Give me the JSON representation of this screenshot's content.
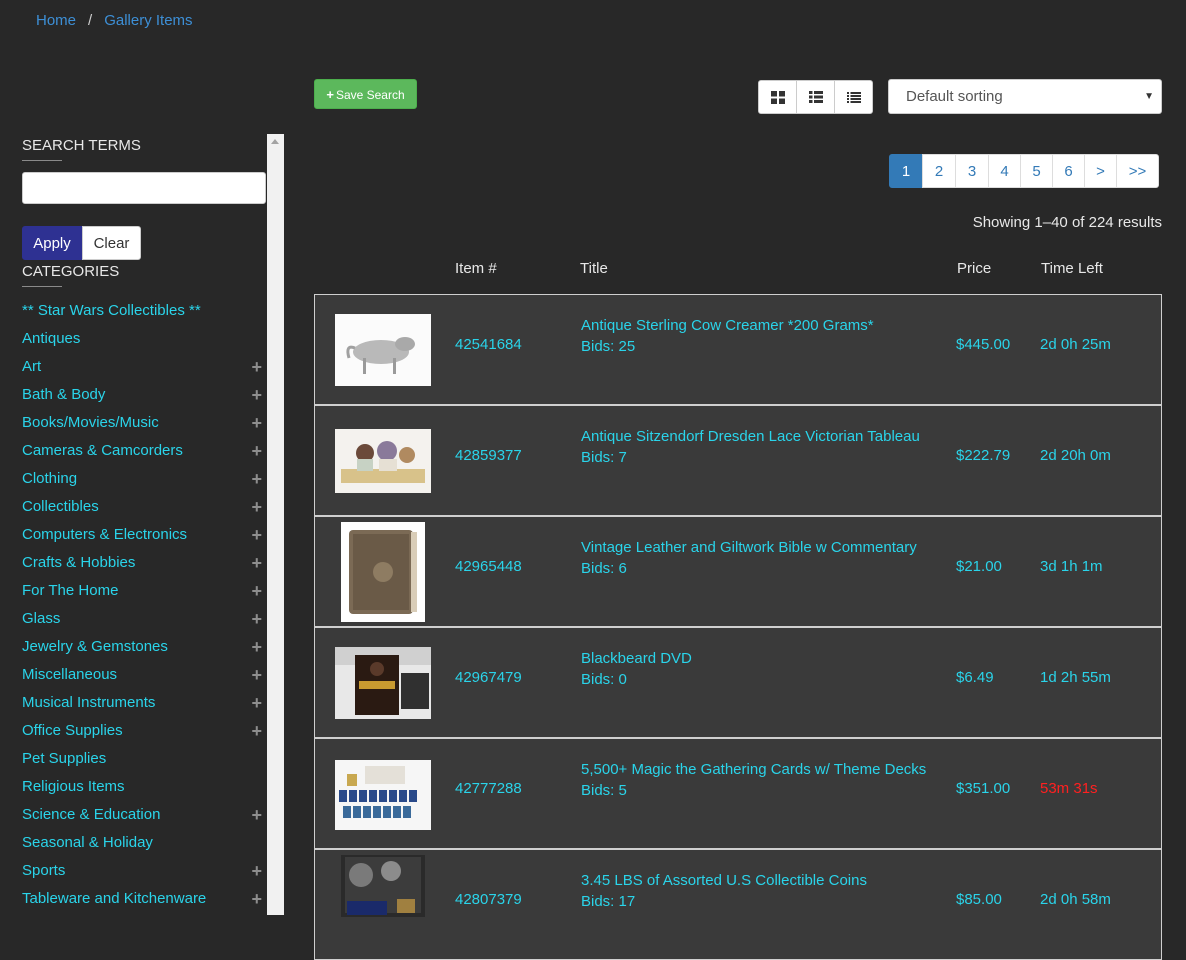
{
  "breadcrumb": {
    "home": "Home",
    "separator": "/",
    "current": "Gallery Items"
  },
  "sidebar": {
    "search_title": "SEARCH TERMS",
    "search_value": "",
    "apply_label": "Apply",
    "clear_label": "Clear",
    "categories_title": "CATEGORIES",
    "categories": [
      {
        "label": "** Star Wars Collectibles **",
        "expandable": false
      },
      {
        "label": "Antiques",
        "expandable": false
      },
      {
        "label": "Art",
        "expandable": true
      },
      {
        "label": "Bath & Body",
        "expandable": true
      },
      {
        "label": "Books/Movies/Music",
        "expandable": true
      },
      {
        "label": "Cameras & Camcorders",
        "expandable": true
      },
      {
        "label": "Clothing",
        "expandable": true
      },
      {
        "label": "Collectibles",
        "expandable": true
      },
      {
        "label": "Computers & Electronics",
        "expandable": true
      },
      {
        "label": "Crafts & Hobbies",
        "expandable": true
      },
      {
        "label": "For The Home",
        "expandable": true
      },
      {
        "label": "Glass",
        "expandable": true
      },
      {
        "label": "Jewelry & Gemstones",
        "expandable": true
      },
      {
        "label": "Miscellaneous",
        "expandable": true
      },
      {
        "label": "Musical Instruments",
        "expandable": true
      },
      {
        "label": "Office Supplies",
        "expandable": true
      },
      {
        "label": "Pet Supplies",
        "expandable": false
      },
      {
        "label": "Religious Items",
        "expandable": false
      },
      {
        "label": "Science & Education",
        "expandable": true
      },
      {
        "label": "Seasonal & Holiday",
        "expandable": false
      },
      {
        "label": "Sports",
        "expandable": true
      },
      {
        "label": "Tableware and Kitchenware",
        "expandable": true
      }
    ]
  },
  "toolbar": {
    "save_search_label": "Save Search",
    "view_icons": [
      "grid-view-icon",
      "list-view-icon",
      "compact-list-icon"
    ],
    "sort_selected": "Default sorting"
  },
  "pagination": {
    "pages": [
      "1",
      "2",
      "3",
      "4",
      "5",
      "6",
      ">",
      ">>"
    ],
    "active": "1"
  },
  "results_text": "Showing 1–40 of 224 results",
  "table": {
    "headers": {
      "item": "Item #",
      "title": "Title",
      "price": "Price",
      "time": "Time Left"
    },
    "rows": [
      {
        "item": "42541684",
        "title": "Antique Sterling Cow Creamer *200 Grams*",
        "bids": "Bids: 25",
        "price": "$445.00",
        "time": "2d 0h 25m",
        "urgent": false
      },
      {
        "item": "42859377",
        "title": "Antique Sitzendorf Dresden Lace Victorian Tableau",
        "bids": "Bids: 7",
        "price": "$222.79",
        "time": "2d 20h 0m",
        "urgent": false
      },
      {
        "item": "42965448",
        "title": "Vintage Leather and Giltwork Bible w Commentary",
        "bids": "Bids: 6",
        "price": "$21.00",
        "time": "3d 1h 1m",
        "urgent": false
      },
      {
        "item": "42967479",
        "title": "Blackbeard DVD",
        "bids": "Bids: 0",
        "price": "$6.49",
        "time": "1d 2h 55m",
        "urgent": false
      },
      {
        "item": "42777288",
        "title": "5,500+ Magic the Gathering Cards w/ Theme Decks",
        "bids": "Bids: 5",
        "price": "$351.00",
        "time": "53m 31s",
        "urgent": true
      },
      {
        "item": "42807379",
        "title": "3.45 LBS of Assorted U.S Collectible Coins",
        "bids": "Bids: 17",
        "price": "$85.00",
        "time": "2d 0h 58m",
        "urgent": false
      }
    ]
  },
  "colors": {
    "link": "#2ad4ea",
    "urgent": "#ff2020",
    "apply": "#2e3192",
    "save": "#5cb85c",
    "page_active": "#337ab7"
  }
}
